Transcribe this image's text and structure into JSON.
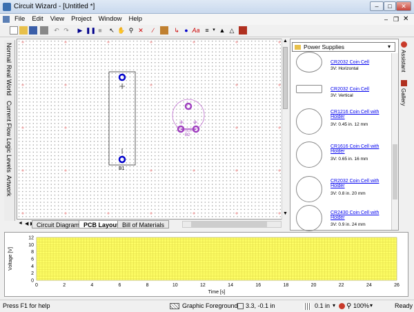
{
  "window": {
    "title": "Circuit Wizard - [Untitled *]",
    "min": "–",
    "max": "□",
    "close": "✕"
  },
  "menu": [
    "File",
    "Edit",
    "View",
    "Project",
    "Window",
    "Help"
  ],
  "side_tabs": [
    "Normal",
    "Real World",
    "Current Flow",
    "Logic Levels",
    "Artwork"
  ],
  "doc_tabs": [
    "Circuit Diagram",
    "PCB Layout",
    "Bill of Materials"
  ],
  "canvas": {
    "b1_label": "B1",
    "b2_label": "B2",
    "plus": "+",
    "minus": "–"
  },
  "gallery": {
    "category": "Power Supplies",
    "items": [
      {
        "name": "CR2032 Coin Cell",
        "desc": "3V: Horizontal"
      },
      {
        "name": "CR2032 Coin Cell",
        "desc": "3V: Vertical"
      },
      {
        "name": "CR1216 Coin Cell with Holder",
        "desc": "3V: 0.45 in. 12 mm"
      },
      {
        "name": "CR1616 Coin Cell with Holder",
        "desc": "3V: 0.65 in. 16 mm"
      },
      {
        "name": "CR2032 Coin Cell with Holder",
        "desc": "3V: 0.8 in. 20 mm"
      },
      {
        "name": "CR2430 Coin Cell with Holder",
        "desc": "3V: 0.9 in. 24 mm"
      }
    ]
  },
  "right_tabs": [
    "Assistant",
    "Gallery"
  ],
  "chart_data": {
    "type": "line",
    "x": [],
    "series": [],
    "xlabel": "Time [s]",
    "ylabel": "Voltage [V]",
    "xlim": [
      0,
      26
    ],
    "ylim": [
      0,
      12
    ],
    "xticks": [
      0,
      2,
      4,
      6,
      8,
      10,
      12,
      14,
      16,
      18,
      20,
      22,
      24,
      26
    ],
    "yticks": [
      0,
      2,
      4,
      6,
      8,
      10,
      12
    ],
    "grid": true,
    "background": "#ffff66"
  },
  "status": {
    "help": "Press F1 for help",
    "layer": "Graphic Foreground",
    "coords": "3.3, -0.1 in",
    "grid": "0.1 in",
    "zoom": "100%",
    "state": "Ready"
  },
  "colors": {
    "pad": "#0000cc",
    "b2": "#a040c0",
    "accent": "#c8d8ee"
  }
}
